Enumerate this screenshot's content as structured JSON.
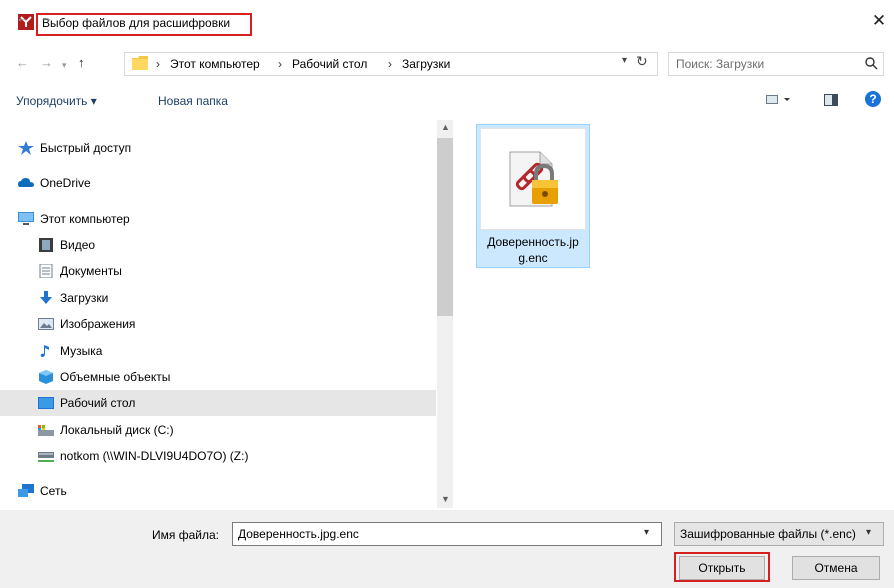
{
  "window": {
    "title": "Выбор файлов для расшифровки",
    "close_icon": "close-icon",
    "accent_color": "#d42020"
  },
  "navigation": {
    "back_icon": "back-arrow-icon",
    "forward_icon": "forward-arrow-icon",
    "recent_icon": "chevron-down-icon",
    "up_icon": "up-arrow-icon"
  },
  "address": {
    "breadcrumbs": [
      "Этот компьютер",
      "Рабочий стол",
      "Загрузки"
    ],
    "separator": "›",
    "dropdown_icon": "chevron-down-icon",
    "refresh_icon": "refresh-icon"
  },
  "search": {
    "placeholder": "Поиск: Загрузки",
    "icon": "search-icon"
  },
  "toolbar": {
    "organize_label": "Упорядочить ▾",
    "new_folder_label": "Новая папка",
    "view_icon": "view-options-icon",
    "pane_icon": "preview-pane-icon",
    "help_icon": "help-icon"
  },
  "sidebar": {
    "items": [
      {
        "label": "Быстрый доступ",
        "icon": "star-icon",
        "level": 0
      },
      {
        "label": "OneDrive",
        "icon": "cloud-icon",
        "level": 0
      },
      {
        "label": "Этот компьютер",
        "icon": "computer-icon",
        "level": 0
      },
      {
        "label": "Видео",
        "icon": "video-icon",
        "level": 1
      },
      {
        "label": "Документы",
        "icon": "document-icon",
        "level": 1
      },
      {
        "label": "Загрузки",
        "icon": "download-icon",
        "level": 1
      },
      {
        "label": "Изображения",
        "icon": "image-icon",
        "level": 1
      },
      {
        "label": "Музыка",
        "icon": "music-icon",
        "level": 1
      },
      {
        "label": "Объемные объекты",
        "icon": "cube-icon",
        "level": 1
      },
      {
        "label": "Рабочий стол",
        "icon": "desktop-icon",
        "level": 1,
        "selected": true
      },
      {
        "label": "Локальный диск (C:)",
        "icon": "drive-icon",
        "level": 1
      },
      {
        "label": "notkom (\\\\WIN-DLVI9U4DO7O) (Z:)",
        "icon": "network-drive-icon",
        "level": 1
      },
      {
        "label": "Сеть",
        "icon": "network-icon",
        "level": 0
      }
    ]
  },
  "files": [
    {
      "name": "Доверенность.jpg.enc",
      "icon": "encrypted-file-icon",
      "selected": true
    }
  ],
  "file_display_lines": [
    "Доверенность.jp",
    "g.enc"
  ],
  "footer": {
    "filename_label": "Имя файла:",
    "filename_value": "Доверенность.jpg.enc",
    "filter_value": "Зашифрованные файлы (*.enc)",
    "open_label": "Открыть",
    "cancel_label": "Отмена"
  }
}
